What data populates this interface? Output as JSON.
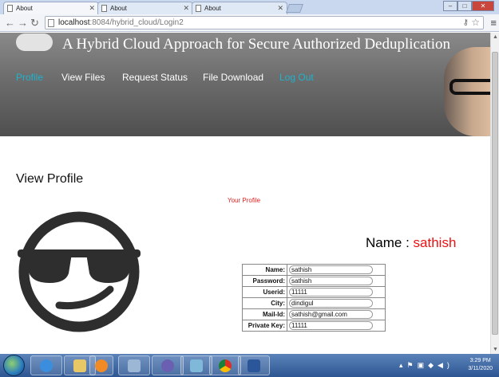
{
  "browser": {
    "tabs": [
      {
        "label": "About",
        "active": true
      },
      {
        "label": "About",
        "active": false
      },
      {
        "label": "About",
        "active": false
      }
    ],
    "url_host": "localhost",
    "url_path": ":8084/hybrid_cloud/Login2"
  },
  "site": {
    "title": "A Hybrid Cloud Approach for Secure Authorized Deduplication",
    "nav": [
      {
        "label": "Profile",
        "color": "#1fb2ce"
      },
      {
        "label": "View Files",
        "color": "#ffffff"
      },
      {
        "label": "Request Status",
        "color": "#ffffff"
      },
      {
        "label": "File Download",
        "color": "#ffffff"
      },
      {
        "label": "Log Out",
        "color": "#1fb2ce"
      }
    ]
  },
  "page": {
    "heading": "View Profile",
    "your_profile": "Your Profile",
    "name_label": "Name : ",
    "name_value": "sathish",
    "fields": [
      {
        "label": "Name:",
        "value": "sathish"
      },
      {
        "label": "Password:",
        "value": "sathish"
      },
      {
        "label": "Userid:",
        "value": "11111"
      },
      {
        "label": "City:",
        "value": "dindigul"
      },
      {
        "label": "Mail-Id:",
        "value": "sathish@gmail.com"
      },
      {
        "label": "Private Key:",
        "value": "11111"
      }
    ]
  },
  "taskbar": {
    "time": "3:29 PM",
    "date": "3/11/2020"
  }
}
